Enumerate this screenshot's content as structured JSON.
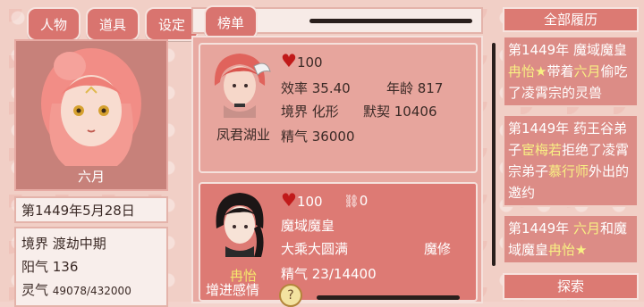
{
  "nav": {
    "tabs": [
      "人物",
      "道具",
      "设定",
      "榜单"
    ]
  },
  "player": {
    "name": "六月",
    "date": "第1449年5月28日",
    "realm": "境界 渡劫中期",
    "yang": "阳气 136",
    "lingqi_label": "灵气",
    "lingqi_value": "49078/432000"
  },
  "cards": [
    {
      "name": "凤君湖业",
      "heart": "100",
      "efficiency": "效率 35.40",
      "age": "年龄 817",
      "realm": "境界 化形",
      "bond": "默契 10406",
      "jingqi": "精气 36000"
    },
    {
      "name": "冉怡",
      "heart": "100",
      "cuffs": "0",
      "title": "魔域魔皇",
      "realm": "大乘大圆满",
      "role": "魔修",
      "jingqi": "精气 23/14400",
      "action": "增进感情",
      "help": "?"
    }
  ],
  "history": {
    "title": "全部履历",
    "items": [
      {
        "pre": "第1449年 魔域魔皇",
        "hl": "冉怡★",
        "post": "带着",
        "hl2": "六月",
        "post2": "偷吃了凌霄宗的灵兽"
      },
      {
        "pre": "第1449年 药王谷弟子",
        "hl": "宦梅若",
        "post": "拒绝了凌霄宗弟子",
        "hl2": "慕行师",
        "post2": "外出的邀约"
      },
      {
        "pre": "第1449年 ",
        "hl": "六月",
        "post": "和魔域魔皇",
        "hl2": "冉怡★",
        "post2": ""
      }
    ]
  },
  "explore_label": "探索",
  "colors": {
    "tab": "#d9746f",
    "highlight": "#f8f083",
    "heart": "#c11a1a"
  }
}
